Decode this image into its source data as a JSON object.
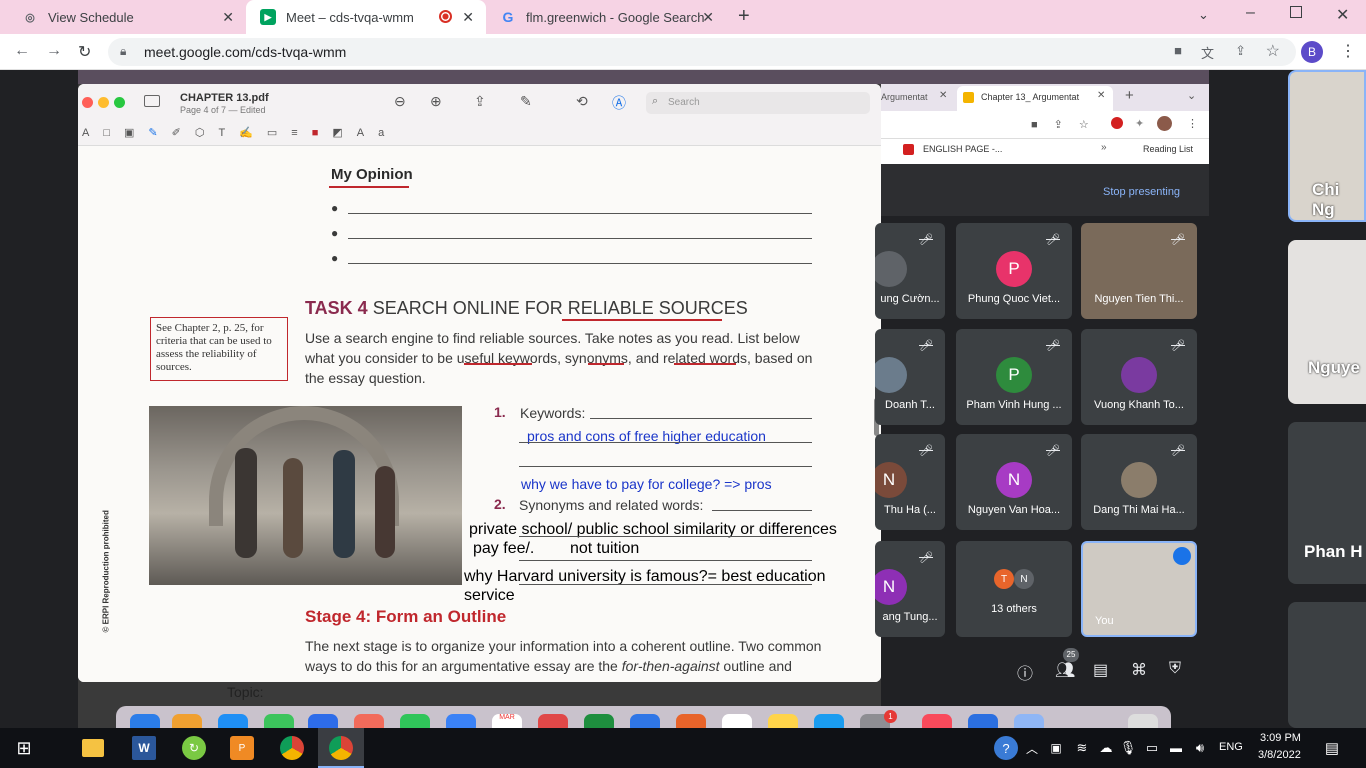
{
  "tabs": [
    {
      "title": "View Schedule",
      "fav": "globe-icon"
    },
    {
      "title": "Meet – cds-tvqa-wmm",
      "fav": "meet-icon"
    },
    {
      "title": "flm.greenwich - Google Search",
      "fav": "google-icon"
    }
  ],
  "omnibox": {
    "url": "meet.google.com/cds-tvqa-wmm"
  },
  "profile": {
    "initial": "B"
  },
  "pdf": {
    "filename": "CHAPTER 13.pdf",
    "subtitle": "Page 4 of 7 — Edited",
    "search_placeholder": "Search",
    "opinion_heading": "My Opinion",
    "task_title": "TASK 4",
    "task_heading": "SEARCH ONLINE FOR RELIABLE SOURCES",
    "sidebar_note": "See Chapter 2, p. 25, for criteria that can be used to assess the reliability of sources.",
    "task_body": "Use a search engine to find reliable sources. Take notes as you read. List below what you consider to be useful keywords, synonyms, and related words, based on the essay question.",
    "item1_num": "1.",
    "item1_label": "Keywords:",
    "item1_note_a": "pros and cons of free higher education",
    "item1_note_b": "why we have to pay for college? => pros",
    "item2_num": "2.",
    "item2_label": "Synonyms and related words:",
    "hand1": "private school/ public school similarity or differences",
    "hand2": "pay fee/.        not tuition",
    "hand3": "why Harvard university is famous?= best education",
    "hand4": "service",
    "stage_heading": "Stage 4: Form an Outline",
    "stage_body1": "The next stage is to organize your information into a coherent outline. Two common",
    "stage_body2_a": "ways to do this for an argumentative essay are the ",
    "stage_body2_em": "for-then-against",
    "stage_body2_b": " outline and",
    "copyright": "© ERPI Reproduction prohibited",
    "topic": "Topic:"
  },
  "browser2": {
    "tab1": "Argumentat",
    "tab2": "Chapter 13_ Argumentat",
    "bookmark": "ENGLISH PAGE -...",
    "reading_list": "Reading List"
  },
  "meet": {
    "stop_presenting": "Stop presenting",
    "participant_count": "25",
    "tiles": [
      {
        "name": "ung Cườn...",
        "initial": "",
        "color": "#5f6368",
        "muted": true
      },
      {
        "name": "Phung Quoc Viet...",
        "initial": "P",
        "color": "#e8336a",
        "muted": true
      },
      {
        "name": "Nguyen Tien Thi...",
        "initial": "",
        "color": "#6d6256",
        "muted": true
      },
      {
        "name": "Doanh T...",
        "initial": "",
        "color": "#6b7c8c",
        "muted": true
      },
      {
        "name": "Pham Vinh Hung ...",
        "initial": "P",
        "color": "#2e8b3d",
        "muted": true
      },
      {
        "name": "Vuong Khanh To...",
        "initial": "",
        "color": "#7a3aa0",
        "muted": true
      },
      {
        "name": "Thu Ha (...",
        "initial": "N",
        "color": "#7a4a3a",
        "muted": true
      },
      {
        "name": "Nguyen Van Hoa...",
        "initial": "N",
        "color": "#a73bc4",
        "muted": true
      },
      {
        "name": "Dang Thi Mai Ha...",
        "initial": "",
        "color": "#8b7d6b",
        "muted": true
      },
      {
        "name": "ang Tung...",
        "initial": "N",
        "color": "#8e2fb5",
        "muted": true
      },
      {
        "name": "13 others",
        "initial": "",
        "color": "#3c4043",
        "muted": false
      },
      {
        "name": "You",
        "initial": "",
        "color": "#9aa0a6",
        "muted": false
      }
    ],
    "others_initials": [
      "T",
      "N"
    ]
  },
  "right_strip": {
    "tile1": "Chi Ng",
    "tile2": "Nguye",
    "tile3": "Phan H"
  },
  "taskbar": {
    "language": "ENG",
    "time": "3:09 PM",
    "date": "3/8/2022",
    "dock_calendar": "MAR",
    "dock_badge": "1"
  }
}
